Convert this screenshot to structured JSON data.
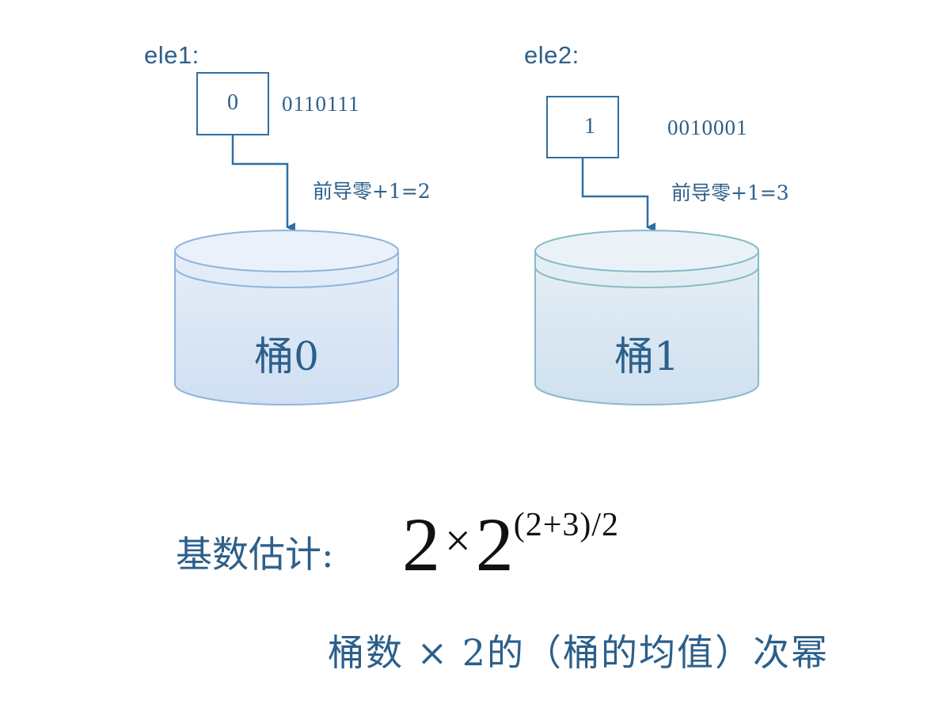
{
  "elements": [
    {
      "label": "ele1:",
      "value": "0",
      "bits": "0110111",
      "note": "前导零+1=2"
    },
    {
      "label": "ele2:",
      "value": "1",
      "bits": "0010001",
      "note": "前导零+1=3"
    }
  ],
  "buckets": [
    {
      "label": "桶0"
    },
    {
      "label": "桶1"
    }
  ],
  "formula": {
    "label": "基数估计:",
    "base_coef": "2",
    "times": "×",
    "power_base": "2",
    "exponent": "(2+3)/2"
  },
  "caption": "桶数 × 2的（桶的均值）次幂",
  "colors": {
    "text": "#2c5f8a",
    "line": "#2e6fa6",
    "bucket0_stroke": "#8fb4de",
    "bucket1_stroke": "#86bcc6",
    "bucket_fill": "#dde8f5"
  }
}
